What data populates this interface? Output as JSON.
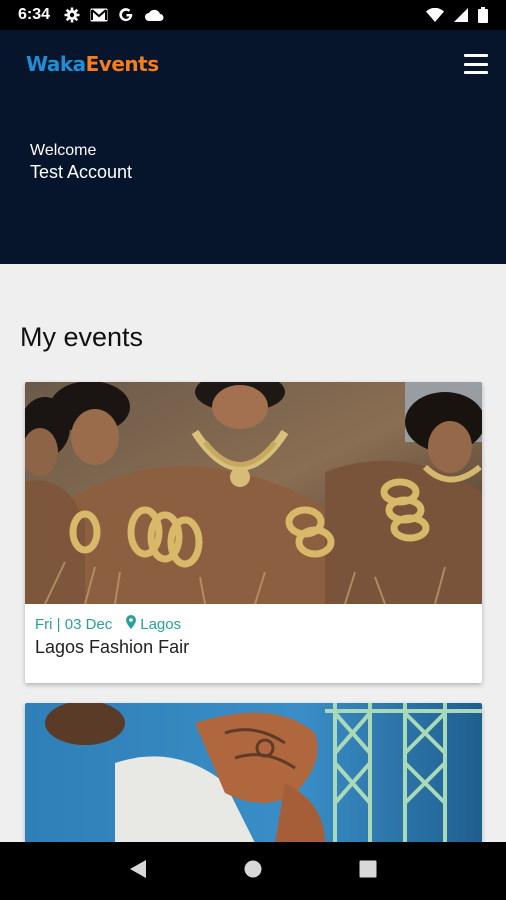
{
  "status_bar": {
    "time": "6:34",
    "left_icons": [
      "gear-icon",
      "gmail-icon",
      "google-icon",
      "cloud-icon"
    ],
    "right_icons": [
      "wifi-icon",
      "signal-icon",
      "battery-icon"
    ]
  },
  "header": {
    "logo_part1": "Waka",
    "logo_part2": "Events",
    "welcome": "Welcome",
    "user_name": "Test Account",
    "colors": {
      "background": "#06142c",
      "logo_blue": "#1e8fd6",
      "logo_orange": "#f57c20"
    }
  },
  "main": {
    "section_title": "My events",
    "events": [
      {
        "date": "Fri | 03 Dec",
        "location": "Lagos",
        "title": "Lagos Fashion Fair"
      }
    ],
    "accent_color": "#2aa198"
  },
  "nav_bar": {
    "buttons": [
      "back-icon",
      "home-icon",
      "recents-icon"
    ]
  }
}
